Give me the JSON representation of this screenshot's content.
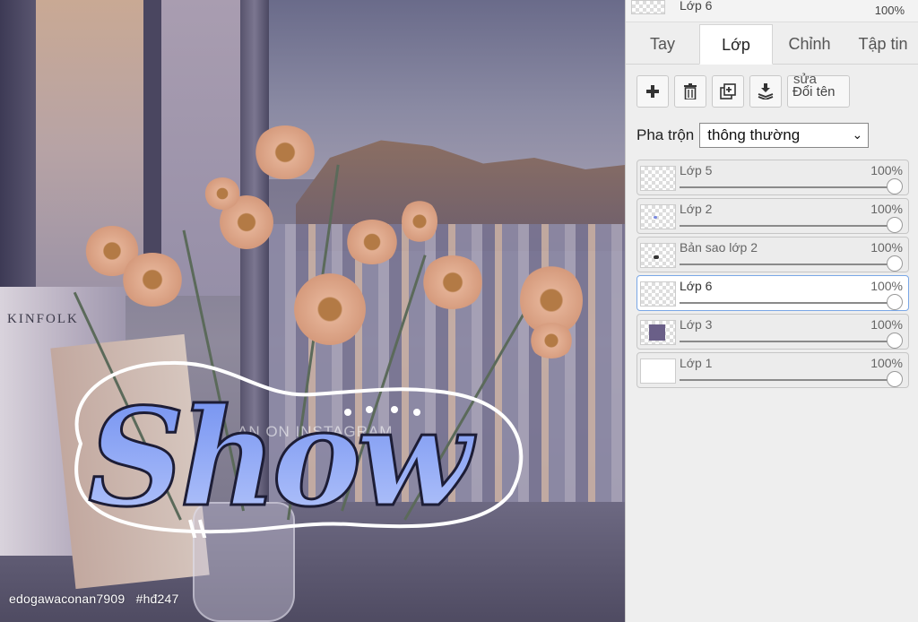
{
  "canvas": {
    "word_art_text": "Show",
    "faint_text": "AN ON INSTAGRAM",
    "book_text": "KINFOLK",
    "watermark": "edogawaconan7909   #hđ247"
  },
  "panel": {
    "top_layer": {
      "name": "Lớp 6",
      "opacity": "100%"
    },
    "tabs": [
      {
        "label": "Tay"
      },
      {
        "label": "Lớp"
      },
      {
        "label": "Chỉnh"
      },
      {
        "label": "Tập tin"
      }
    ],
    "active_tab": "Lớp",
    "toolbar": {
      "add_icon": "plus-icon",
      "delete_icon": "trash-icon",
      "duplicate_icon": "duplicate-icon",
      "merge_icon": "merge-down-icon",
      "rename_top": "sửa",
      "rename_label": "Đổi tên"
    },
    "blend": {
      "label": "Pha trộn",
      "value": "thông thường"
    },
    "layers": [
      {
        "name": "Lớp 5",
        "opacity": "100%",
        "selected": false
      },
      {
        "name": "Lớp 2",
        "opacity": "100%",
        "selected": false
      },
      {
        "name": "Bản sao lớp 2",
        "opacity": "100%",
        "selected": false
      },
      {
        "name": "Lớp 6",
        "opacity": "100%",
        "selected": true
      },
      {
        "name": "Lớp 3",
        "opacity": "100%",
        "selected": false
      },
      {
        "name": "Lớp 1",
        "opacity": "100%",
        "selected": false
      }
    ],
    "slider_level": 1.0,
    "selection_color": "#7aa7e6"
  }
}
